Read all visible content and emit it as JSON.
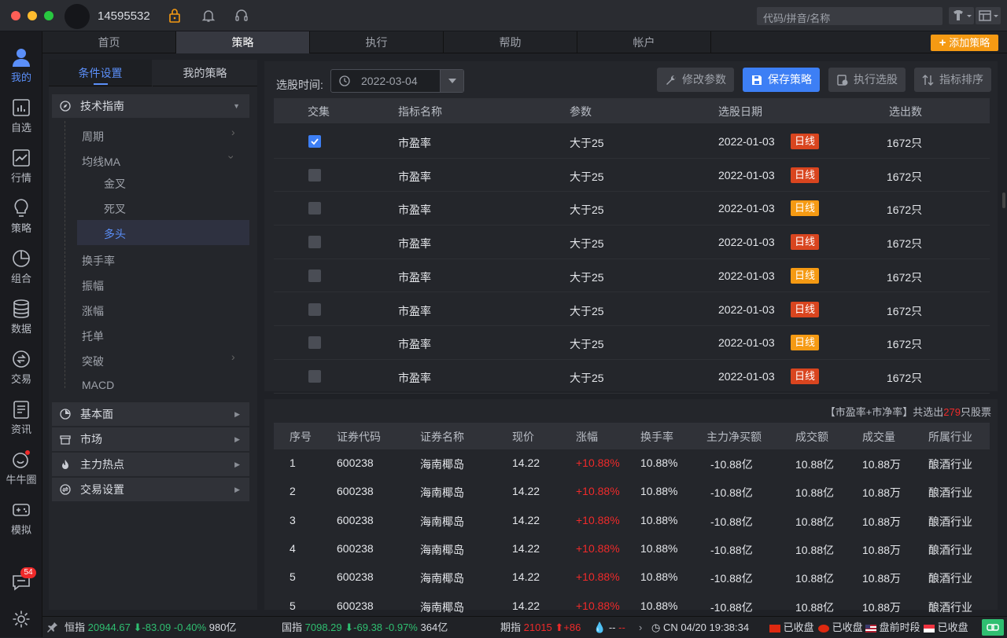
{
  "user": {
    "id": "14595532"
  },
  "search": {
    "placeholder": "代码/拼音/名称"
  },
  "nav": {
    "items": [
      {
        "label": "我的",
        "icon": "user-icon"
      },
      {
        "label": "自选",
        "icon": "bar-chart-icon"
      },
      {
        "label": "行情",
        "icon": "line-chart-icon"
      },
      {
        "label": "策略",
        "icon": "bulb-icon"
      },
      {
        "label": "组合",
        "icon": "pie-chart-icon"
      },
      {
        "label": "数据",
        "icon": "database-icon"
      },
      {
        "label": "交易",
        "icon": "exchange-icon"
      },
      {
        "label": "资讯",
        "icon": "news-icon"
      },
      {
        "label": "牛牛圈",
        "icon": "circle-icon"
      },
      {
        "label": "模拟",
        "icon": "gamepad-icon"
      }
    ],
    "message_badge": "54"
  },
  "tabs": [
    "首页",
    "策略",
    "执行",
    "帮助",
    "帐户"
  ],
  "add_strategy": "添加策略",
  "left": {
    "tabs": [
      "条件设置",
      "我的策略"
    ],
    "tech_title": "技术指南",
    "tech_items": [
      "周期",
      "均线MA",
      "金叉",
      "死叉",
      "多头",
      "换手率",
      "振幅",
      "涨幅",
      "托单",
      "突破",
      "MACD"
    ],
    "sections": [
      "基本面",
      "市场",
      "主力热点",
      "交易设置"
    ]
  },
  "toolbar": {
    "date_label": "选股时间:",
    "date": "2022-03-04",
    "buttons": [
      "修改参数",
      "保存策略",
      "执行选股",
      "指标排序"
    ]
  },
  "criteria": {
    "headers": [
      "交集",
      "指标名称",
      "参数",
      "选股日期",
      "选出数"
    ],
    "rows": [
      {
        "checked": true,
        "name": "市盈率",
        "param": "大于25",
        "date": "2022-01-03",
        "tag": "日线",
        "tag_color": "#d9451f",
        "count": "1672只"
      },
      {
        "checked": false,
        "name": "市盈率",
        "param": "大于25",
        "date": "2022-01-03",
        "tag": "日线",
        "tag_color": "#d9451f",
        "count": "1672只"
      },
      {
        "checked": false,
        "name": "市盈率",
        "param": "大于25",
        "date": "2022-01-03",
        "tag": "日线",
        "tag_color": "#f59a13",
        "count": "1672只"
      },
      {
        "checked": false,
        "name": "市盈率",
        "param": "大于25",
        "date": "2022-01-03",
        "tag": "日线",
        "tag_color": "#d9451f",
        "count": "1672只"
      },
      {
        "checked": false,
        "name": "市盈率",
        "param": "大于25",
        "date": "2022-01-03",
        "tag": "日线",
        "tag_color": "#f59a13",
        "count": "1672只"
      },
      {
        "checked": false,
        "name": "市盈率",
        "param": "大于25",
        "date": "2022-01-03",
        "tag": "日线",
        "tag_color": "#d9451f",
        "count": "1672只"
      },
      {
        "checked": false,
        "name": "市盈率",
        "param": "大于25",
        "date": "2022-01-03",
        "tag": "日线",
        "tag_color": "#f59a13",
        "count": "1672只"
      },
      {
        "checked": false,
        "name": "市盈率",
        "param": "大于25",
        "date": "2022-01-03",
        "tag": "日线",
        "tag_color": "#d9451f",
        "count": "1672只"
      }
    ]
  },
  "results": {
    "summary_prefix": "【市盈率+市净率】共选出",
    "summary_count": "279",
    "summary_suffix": "只股票",
    "headers": [
      "序号",
      "证券代码",
      "证券名称",
      "现价",
      "涨幅",
      "换手率",
      "主力净买额",
      "成交额",
      "成交量",
      "所属行业"
    ],
    "rows": [
      [
        "1",
        "600238",
        "海南椰岛",
        "14.22",
        "+10.88%",
        "10.88%",
        "-10.88亿",
        "10.88亿",
        "10.88万",
        "酿酒行业"
      ],
      [
        "2",
        "600238",
        "海南椰岛",
        "14.22",
        "+10.88%",
        "10.88%",
        "-10.88亿",
        "10.88亿",
        "10.88万",
        "酿酒行业"
      ],
      [
        "3",
        "600238",
        "海南椰岛",
        "14.22",
        "+10.88%",
        "10.88%",
        "-10.88亿",
        "10.88亿",
        "10.88万",
        "酿酒行业"
      ],
      [
        "4",
        "600238",
        "海南椰岛",
        "14.22",
        "+10.88%",
        "10.88%",
        "-10.88亿",
        "10.88亿",
        "10.88万",
        "酿酒行业"
      ],
      [
        "5",
        "600238",
        "海南椰岛",
        "14.22",
        "+10.88%",
        "10.88%",
        "-10.88亿",
        "10.88亿",
        "10.88万",
        "酿酒行业"
      ],
      [
        "5",
        "600238",
        "海南椰岛",
        "14.22",
        "+10.88%",
        "10.88%",
        "-10.88亿",
        "10.88亿",
        "10.88万",
        "酿酒行业"
      ]
    ]
  },
  "status": {
    "hs": {
      "name": "恒指",
      "value": "20944.67",
      "change": "-83.09",
      "pct": "-0.40%",
      "vol": "980亿"
    },
    "gz": {
      "name": "国指",
      "value": "7098.29",
      "change": "-69.38",
      "pct": "-0.97%",
      "vol": "364亿"
    },
    "qz": {
      "name": "期指",
      "value": "21015",
      "change": "+86"
    },
    "dash": "--",
    "time": "CN 04/20 19:38:34",
    "markets": [
      "已收盘",
      "已收盘",
      "盘前时段",
      "已收盘"
    ]
  },
  "colors": {
    "accent": "#3d7ff5",
    "orange": "#f59a13",
    "up": "#ef2a2a",
    "down": "#2fbf71"
  }
}
